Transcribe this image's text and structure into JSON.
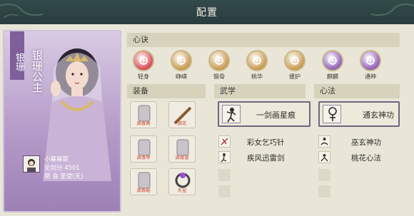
{
  "header": {
    "title": "配置"
  },
  "character": {
    "title_vertical": "银珊",
    "name_vertical": "银珊公主",
    "player_name": "小幂幂耶",
    "score": "论剑分 4501",
    "guild": "帮 会 圣堂(天)"
  },
  "sections": {
    "xinjue": "心诀",
    "zhuangbei": "装备",
    "wuxue": "武学",
    "xinfa": "心法"
  },
  "xinjue_skills": [
    {
      "label": "轻身",
      "color": "#d94a55",
      "icon": "boot-icon"
    },
    {
      "label": "峥嵘",
      "color": "#c99a4e",
      "icon": "bird-icon"
    },
    {
      "label": "锻骨",
      "color": "#c99a4e",
      "icon": "sun-icon"
    },
    {
      "label": "桃华",
      "color": "#c99a4e",
      "icon": "peach-icon"
    },
    {
      "label": "援护",
      "color": "#c99a4e",
      "icon": "crane-icon"
    },
    {
      "label": "麒麟",
      "color": "#8f60b8",
      "icon": "qilin-icon"
    },
    {
      "label": "通神",
      "color": "#8f60b8",
      "icon": "spirit-icon"
    }
  ],
  "equipment": [
    {
      "tag": "满尊胄",
      "name": "helmet"
    },
    {
      "tag": "满花",
      "name": "staff"
    },
    {
      "tag": "满尊甲",
      "name": "armor"
    },
    {
      "tag": "满尊裳",
      "name": "skirt"
    },
    {
      "tag": "满尊鞋",
      "name": "boots"
    },
    {
      "tag": "天昆",
      "name": "ring"
    }
  ],
  "wuxue": {
    "primary": "一剑画星痕",
    "items": [
      "彩女乞巧针",
      "疾风迅雷剑"
    ]
  },
  "xinfa": {
    "primary": "通玄神功",
    "items": [
      "巫玄神功",
      "桃花心法"
    ]
  }
}
